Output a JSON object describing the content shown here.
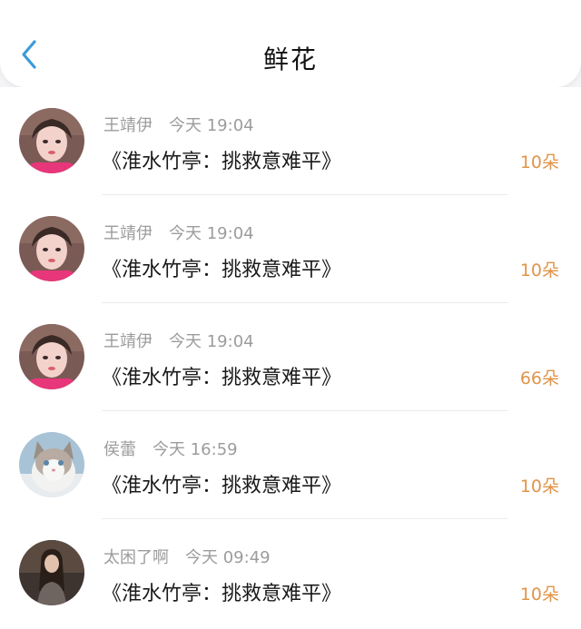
{
  "header": {
    "title": "鲜花",
    "back_icon": "chevron-left-icon",
    "accent_color": "#3a9bdc"
  },
  "records": [
    {
      "user": "王靖伊",
      "time": "今天 19:04",
      "work": "《淮水竹亭：挑救意难平》",
      "amount": "10朵",
      "avatar": "woman-portrait"
    },
    {
      "user": "王靖伊",
      "time": "今天 19:04",
      "work": "《淮水竹亭：挑救意难平》",
      "amount": "10朵",
      "avatar": "woman-portrait"
    },
    {
      "user": "王靖伊",
      "time": "今天 19:04",
      "work": "《淮水竹亭：挑救意难平》",
      "amount": "66朵",
      "avatar": "woman-portrait"
    },
    {
      "user": "侯蕾",
      "time": "今天 16:59",
      "work": "《淮水竹亭：挑救意难平》",
      "amount": "10朵",
      "avatar": "cat-photo"
    },
    {
      "user": "太困了啊",
      "time": "今天 09:49",
      "work": "《淮水竹亭：挑救意难平》",
      "amount": "10朵",
      "avatar": "girl-photo"
    }
  ],
  "colors": {
    "amount": "#e0944a",
    "meta_text": "#9c9c9c",
    "title_text": "#1a1a1a"
  }
}
